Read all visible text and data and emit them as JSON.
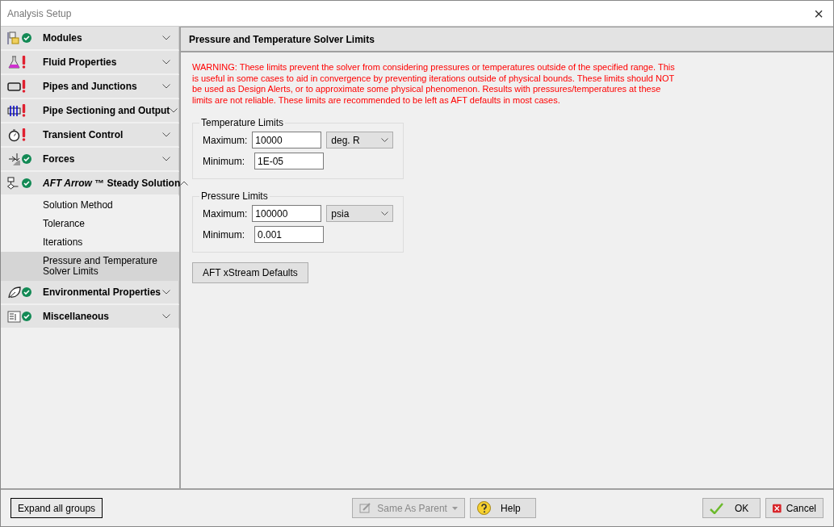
{
  "window": {
    "title": "Analysis Setup",
    "close": "×"
  },
  "sidebar": {
    "groups": [
      {
        "title": "Modules",
        "warning": false,
        "expanded": false
      },
      {
        "title": "Fluid Properties",
        "warning": true,
        "expanded": false
      },
      {
        "title": "Pipes and Junctions",
        "warning": true,
        "expanded": false
      },
      {
        "title": "Pipe Sectioning and Output",
        "warning": true,
        "expanded": false
      },
      {
        "title": "Transient Control",
        "warning": true,
        "expanded": false
      },
      {
        "title": "Forces",
        "warning": false,
        "expanded": false
      },
      {
        "title": "*AFT Arrow* ™ Steady Solution",
        "warning": false,
        "expanded": true,
        "children": [
          {
            "label": "Solution Method",
            "selected": false
          },
          {
            "label": "Tolerance",
            "selected": false
          },
          {
            "label": "Iterations",
            "selected": false
          },
          {
            "label": "Pressure and Temperature Solver Limits",
            "selected": true
          }
        ]
      },
      {
        "title": "Environmental Properties",
        "warning": false,
        "expanded": false
      },
      {
        "title": "Miscellaneous",
        "warning": false,
        "expanded": false
      }
    ]
  },
  "panel": {
    "title": "Pressure and Temperature Solver Limits",
    "warning": "WARNING: These limits prevent the solver from considering pressures or temperatures outside of the specified range. This is useful in some cases to aid in convergence by preventing iterations outside of physical bounds. These limits should NOT be used as Design Alerts, or to approximate some physical phenomenon. Results with pressures/temperatures at these limits are not reliable. These limits are recommended to be left as AFT defaults in most cases.",
    "groups": [
      {
        "title": "Temperature Limits",
        "rows": [
          {
            "label": "Maximum:",
            "value": "10000",
            "unit": "deg. R"
          },
          {
            "label": "Minimum:",
            "value": "1E-05"
          }
        ]
      },
      {
        "title": "Pressure Limits",
        "rows": [
          {
            "label": "Maximum:",
            "value": "100000",
            "unit": "psia"
          },
          {
            "label": "Minimum:",
            "value": "0.001"
          }
        ]
      }
    ],
    "defaults_button": "AFT xStream Defaults"
  },
  "footer": {
    "expand_button": "Expand all groups",
    "same_as_parent": {
      "label": "Same As Parent",
      "disabled": true
    },
    "help": "Help",
    "ok": "OK",
    "cancel": "Cancel"
  }
}
